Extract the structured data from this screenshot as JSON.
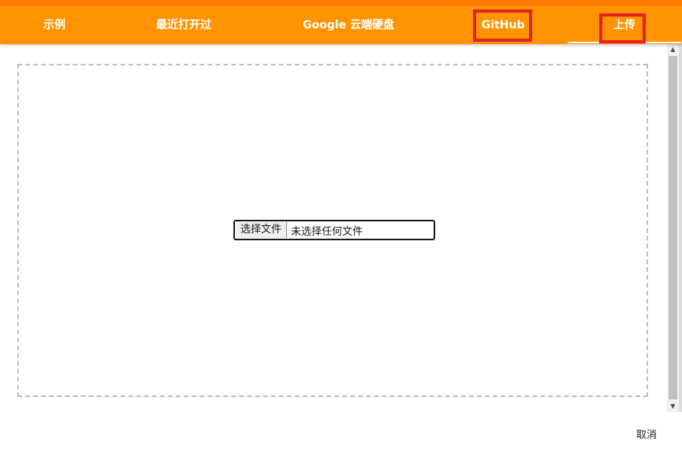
{
  "header": {
    "tabs": [
      {
        "label": "示例"
      },
      {
        "label": "最近打开过"
      },
      {
        "label": "Google 云端硬盘"
      },
      {
        "label": "GitHub"
      },
      {
        "label": "上传"
      }
    ],
    "active_tab": "上传"
  },
  "upload": {
    "choose_button_label": "选择文件",
    "no_file_text": "未选择任何文件"
  },
  "footer": {
    "cancel_label": "取消"
  },
  "colors": {
    "tab_bar": "#ff9400",
    "top_strip": "#ff7b00",
    "highlight_border": "#e8202a"
  },
  "icons": {
    "scroll_up": "scroll-up-arrow-icon",
    "scroll_down": "scroll-down-arrow-icon"
  }
}
